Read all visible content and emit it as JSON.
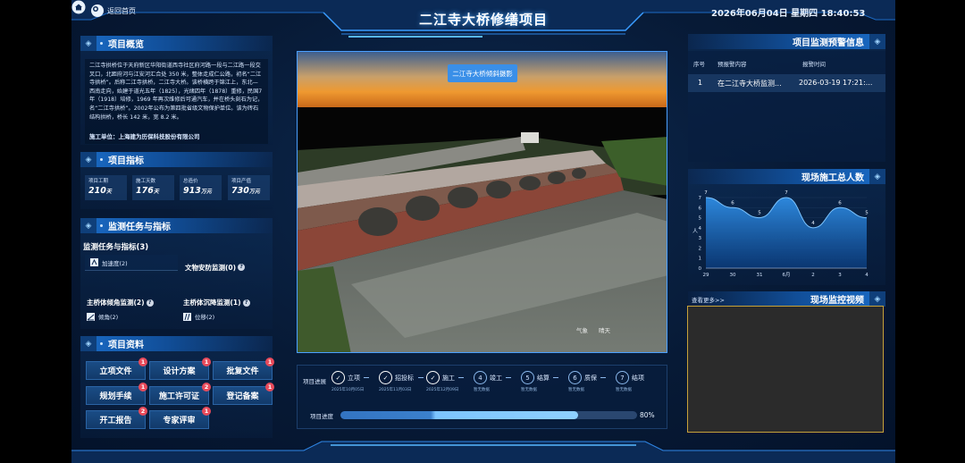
{
  "header": {
    "home_label": "返回首页",
    "title": "二江寺大桥修缮项目",
    "datetime": "2026年06月04日 星期四 18:40:53"
  },
  "overview": {
    "title": "项目概览",
    "text": "二江寺拱桥位于天府新区华阳街道西寺社区府河路一段与二江路一段交叉口，北距府河与江安河汇合处 350 米，整体走成仁公路，初名“二江寺拱桥”。后称二江寺拱桥，二江寺大桥。该桥横跨于锦江上，东北—西南走向，始建于道光五年（1825），光绪四年（1878）重修，民国7年（1918）培修，1969 年再次维修后可通汽车，并在桥头刻石为记，名“二江寺拱桥”。2002年公布为第四批省级文物保护单位。该为砖石结构拱桥，桥长 142 米，宽 8.2 米。",
    "unit_label": "施工单位：上海建为历保科技股份有限公司"
  },
  "indicators": {
    "title": "项目指标",
    "items": [
      {
        "label": "项目工期",
        "value": "210",
        "unit": "天"
      },
      {
        "label": "施工天数",
        "value": "176",
        "unit": "天"
      },
      {
        "label": "总造价",
        "value": "913",
        "unit": "万元"
      },
      {
        "label": "项目产值",
        "value": "730",
        "unit": "万元"
      }
    ]
  },
  "monitoring": {
    "title": "监测任务与指标",
    "subtitle": "监测任务与指标(3)",
    "accel": "加速度(2)",
    "relic": "文物安防监测(0)",
    "tilt_title": "主桥体倾角监测(2)",
    "tilt_item": "倾角(2)",
    "disp_title": "主桥体沉降监测(1)",
    "disp_item": "位移(2)",
    "q": "?"
  },
  "documents": {
    "title": "项目资料",
    "items": [
      {
        "label": "立项文件",
        "badge": "1"
      },
      {
        "label": "设计方案",
        "badge": "1"
      },
      {
        "label": "批复文件",
        "badge": "1"
      },
      {
        "label": "规划手续",
        "badge": "1"
      },
      {
        "label": "施工许可证",
        "badge": "2"
      },
      {
        "label": "登记备案",
        "badge": "1"
      },
      {
        "label": "开工报告",
        "badge": "2"
      },
      {
        "label": "专家评审",
        "badge": "1"
      }
    ]
  },
  "model": {
    "button": "二江寺大桥倾斜摄影",
    "tag1": "气象",
    "tag2": "晴天"
  },
  "progress": {
    "steps_label": "项目进展",
    "steps": [
      {
        "num": "✓",
        "name": "立项",
        "date": "2025年10月05日",
        "done": true
      },
      {
        "num": "✓",
        "name": "招投标",
        "date": "2025年11月03日",
        "done": true
      },
      {
        "num": "✓",
        "name": "施工",
        "date": "2025年12月09日",
        "done": true
      },
      {
        "num": "4",
        "name": "竣工",
        "date": "暂无数据",
        "done": false
      },
      {
        "num": "5",
        "name": "结算",
        "date": "暂无数据",
        "done": false
      },
      {
        "num": "6",
        "name": "质保",
        "date": "暂无数据",
        "done": false
      },
      {
        "num": "7",
        "name": "结项",
        "date": "暂无数据",
        "done": false
      }
    ],
    "bar_label": "项目进度",
    "percent": 80,
    "percent_text": "80%"
  },
  "alerts": {
    "title": "项目监测预警信息",
    "col_no": "序号",
    "col_content": "预报警内容",
    "col_time": "报警时间",
    "rows": [
      {
        "no": "1",
        "content": "在二江寺大桥监测...",
        "time": "2026-03-19 17:21:..."
      }
    ]
  },
  "workers": {
    "title": "现场施工总人数",
    "more": "查看更多>>"
  },
  "video": {
    "title": "现场监控视频"
  },
  "chart_data": {
    "type": "area",
    "categories": [
      "29",
      "30",
      "31",
      "6月",
      "2",
      "3",
      "4"
    ],
    "values": [
      7,
      6,
      5,
      7,
      4,
      6,
      5
    ],
    "ylabel": "人",
    "ylim": [
      0,
      7
    ],
    "yticks": [
      "0",
      "1",
      "2",
      "3",
      "4",
      "5",
      "6",
      "7"
    ],
    "color": "#2f8de4"
  }
}
